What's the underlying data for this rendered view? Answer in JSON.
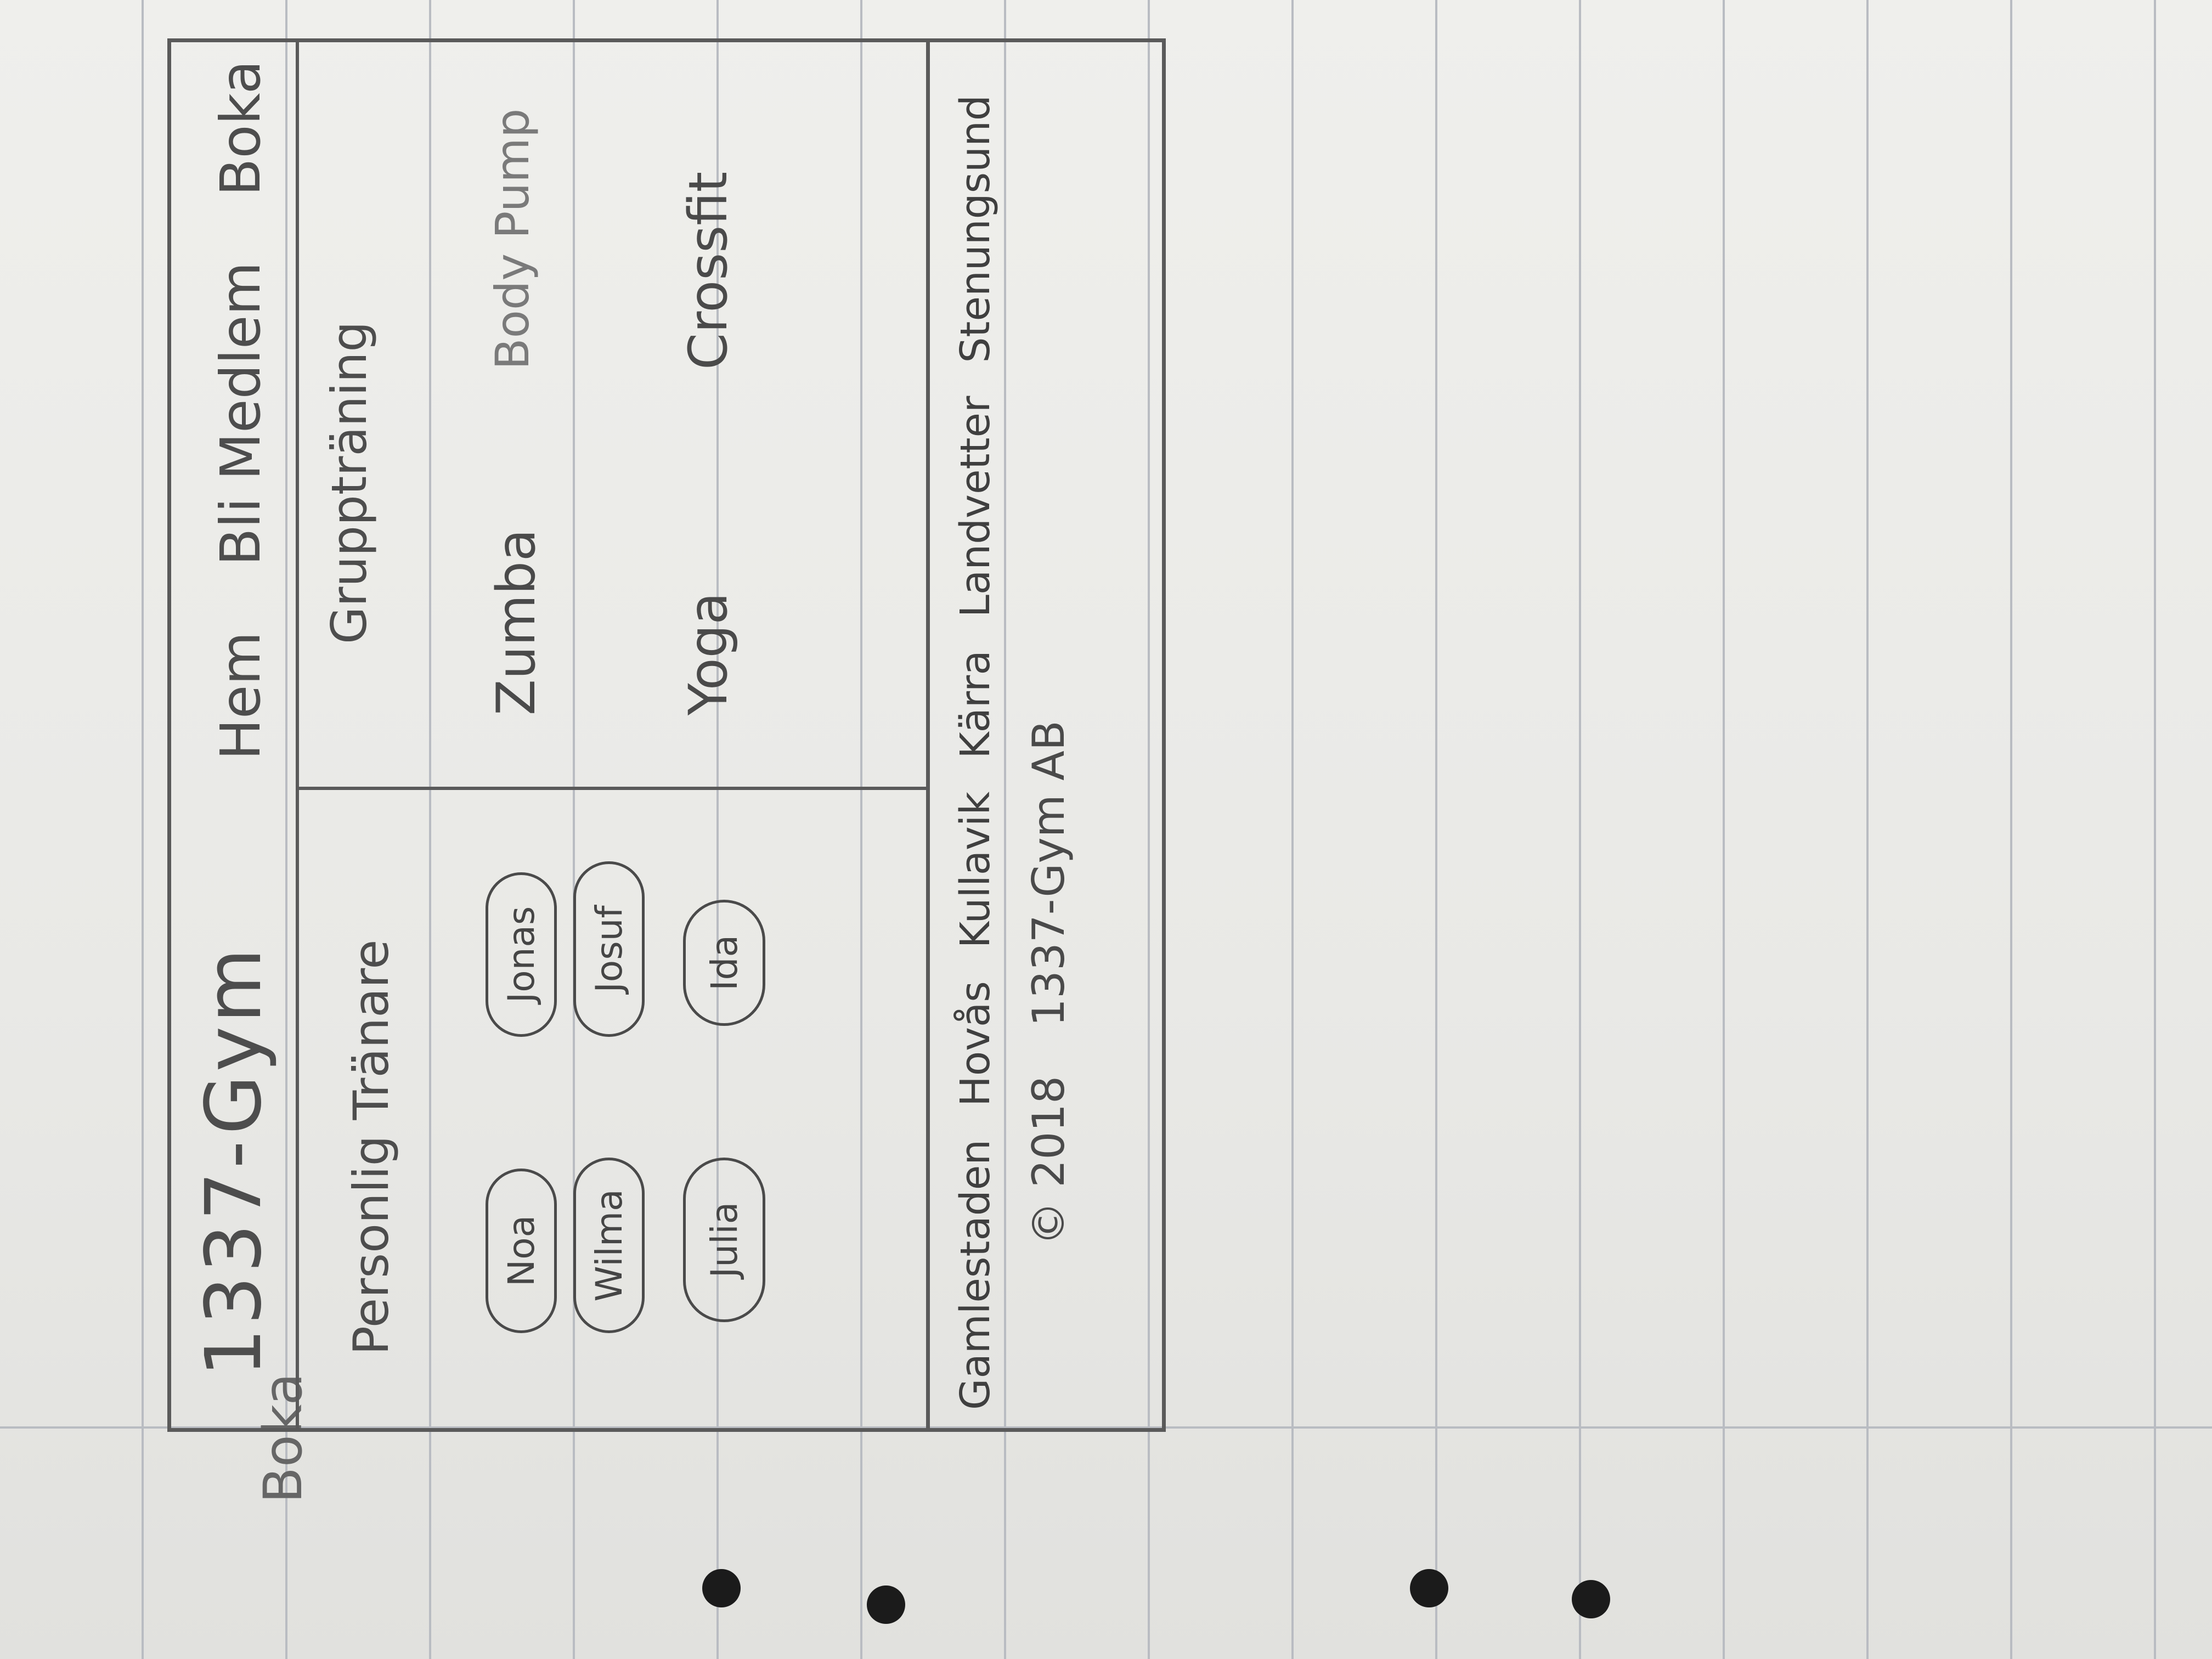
{
  "header": {
    "logo": "1337-Gym",
    "nav": [
      "Hem",
      "Bli Medlem",
      "Boka"
    ]
  },
  "trainers": {
    "title": "Personlig Tränare",
    "names": [
      "Noa",
      "Jonas",
      "Wilma",
      "Josuf",
      "Julia",
      "Ida"
    ]
  },
  "classes": {
    "title": "Gruppträning",
    "items": [
      "Zumba",
      "Body Pump",
      "Yoga",
      "Crossfit"
    ]
  },
  "footer": {
    "locations": [
      "Gamlestaden",
      "Hovås",
      "Kullavik",
      "Kärra",
      "Landvetter",
      "Stenungsund"
    ],
    "year": "2018",
    "company": "1337-Gym AB"
  },
  "margin_note": "Boka"
}
